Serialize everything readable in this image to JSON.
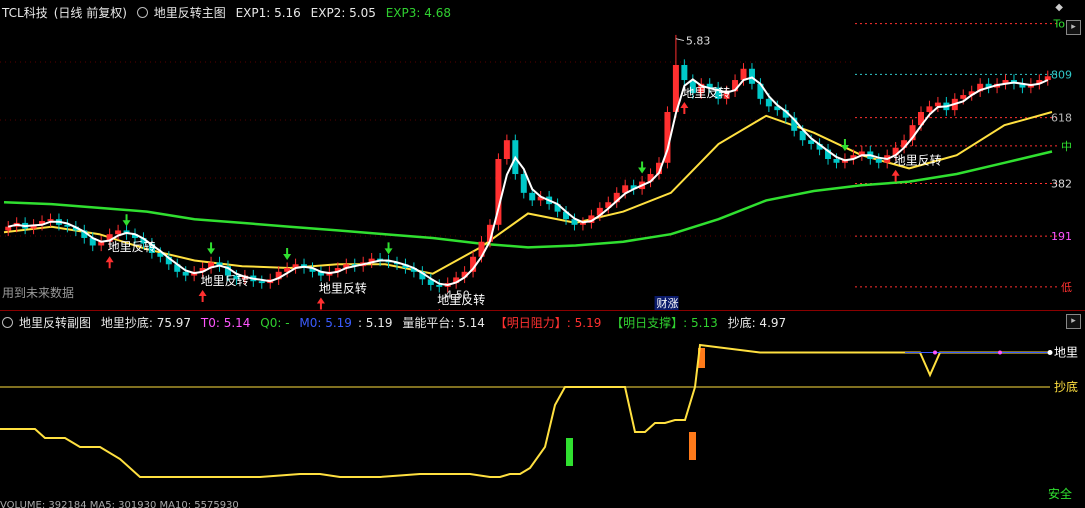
{
  "main_header": {
    "symbol": "TCL科技",
    "mode": "(日线 前复权)",
    "indicator": "地里反转主图",
    "exp1": "EXP1: 5.16",
    "exp2": "EXP2: 5.05",
    "exp3": "EXP3: 4.68"
  },
  "sub_header": {
    "indicator": "地里反转副图",
    "diliang": "地里抄底: 75.97",
    "t0": "T0: 5.14",
    "q0": "Q0: -",
    "m0": "M0: 5.19",
    "val": ": 5.19",
    "platform": "量能平台: 5.14",
    "resist": "【明日阻力】: 5.19",
    "support": "【明日支撑】: 5.13",
    "chaodi": "抄底: 4.97"
  },
  "future_note": "用到未来数据",
  "level_labels": {
    "top": "Top",
    "l809": "809",
    "l618": "618",
    "mid": "中",
    "l382": "382",
    "l191": "191",
    "low": "低"
  },
  "sub_labels": {
    "diliang": "地里",
    "chaodi": "抄底",
    "safe": "安全"
  },
  "footer_text": "VOLUME: 392184 MA5: 301930 MA10: 5575930",
  "colors": {
    "bg": "#000000",
    "up": "#ff3030",
    "down": "#00c8c8",
    "price_line": "#ffffff",
    "ma_yellow": "#ffe040",
    "ma_green": "#30e030",
    "level_dash": "#ff3030",
    "level_cyan": "#30c8c8"
  },
  "chart_data": [
    {
      "type": "candlestick",
      "title": "地里反转主图",
      "y_range": [
        4.45,
        5.95
      ],
      "max_label": "5.83",
      "min_label": "4.50",
      "badge": "财涨",
      "signal_label": "地里反转",
      "signal_bars": [
        12,
        23,
        37,
        51,
        80,
        105
      ],
      "green_arrow_bars": [
        14,
        24,
        33,
        45,
        75,
        99
      ],
      "close": [
        4.84,
        4.86,
        4.83,
        4.85,
        4.87,
        4.88,
        4.85,
        4.84,
        4.82,
        4.78,
        4.74,
        4.76,
        4.8,
        4.82,
        4.8,
        4.78,
        4.75,
        4.7,
        4.68,
        4.64,
        4.6,
        4.58,
        4.6,
        4.62,
        4.65,
        4.63,
        4.58,
        4.56,
        4.58,
        4.55,
        4.54,
        4.56,
        4.6,
        4.62,
        4.64,
        4.62,
        4.6,
        4.58,
        4.6,
        4.62,
        4.64,
        4.63,
        4.65,
        4.67,
        4.66,
        4.65,
        4.64,
        4.62,
        4.6,
        4.56,
        4.53,
        4.52,
        4.54,
        4.57,
        4.6,
        4.68,
        4.76,
        4.85,
        5.2,
        5.3,
        5.12,
        5.02,
        4.98,
        5.0,
        4.96,
        4.92,
        4.88,
        4.85,
        4.86,
        4.9,
        4.94,
        4.97,
        5.02,
        5.06,
        5.04,
        5.08,
        5.12,
        5.18,
        5.45,
        5.7,
        5.62,
        5.55,
        5.6,
        5.58,
        5.52,
        5.56,
        5.62,
        5.68,
        5.6,
        5.52,
        5.48,
        5.46,
        5.42,
        5.35,
        5.3,
        5.28,
        5.25,
        5.2,
        5.18,
        5.2,
        5.22,
        5.24,
        5.2,
        5.18,
        5.22,
        5.26,
        5.3,
        5.38,
        5.45,
        5.48,
        5.5,
        5.46,
        5.52,
        5.54,
        5.56,
        5.6,
        5.58,
        5.6,
        5.62,
        5.6,
        5.58,
        5.6,
        5.62,
        5.64
      ],
      "ma_white_end": 5.64,
      "ma_yellow": [
        4.81,
        4.84,
        4.8,
        4.72,
        4.66,
        4.63,
        4.62,
        4.64,
        4.64,
        4.59,
        4.73,
        4.91,
        4.86,
        4.92,
        5.02,
        5.28,
        5.43,
        5.34,
        5.22,
        5.15,
        5.22,
        5.38,
        5.45
      ],
      "ma_green": [
        4.97,
        4.96,
        4.94,
        4.92,
        4.88,
        4.86,
        4.84,
        4.82,
        4.8,
        4.78,
        4.75,
        4.73,
        4.74,
        4.76,
        4.8,
        4.88,
        4.98,
        5.03,
        5.06,
        5.08,
        5.12,
        5.18,
        5.24
      ],
      "levels": [
        {
          "name": "Top",
          "value": 5.92
        },
        {
          "name": "809",
          "value": 5.65
        },
        {
          "name": "618",
          "value": 5.42
        },
        {
          "name": "中",
          "value": 5.27
        },
        {
          "name": "382",
          "value": 5.07
        },
        {
          "name": "191",
          "value": 4.79
        },
        {
          "name": "低",
          "value": 4.52
        }
      ]
    },
    {
      "type": "line",
      "title": "地里反转副图",
      "y_range": [
        0,
        100
      ],
      "series": [
        {
          "name": "地里抄底",
          "color": "#ffe040",
          "x": [
            0,
            35,
            45,
            65,
            80,
            100,
            120,
            140,
            160,
            180,
            200,
            260,
            300,
            320,
            340,
            380,
            420,
            470,
            490,
            500,
            510,
            520,
            530,
            545,
            555,
            565,
            595,
            625,
            635,
            645,
            655,
            665,
            675,
            685,
            695,
            700,
            760,
            900,
            920,
            930,
            940,
            1050
          ],
          "values": [
            42,
            42,
            36,
            36,
            30,
            30,
            22,
            10,
            10,
            10,
            10,
            10,
            12,
            12,
            10,
            10,
            12,
            12,
            10,
            10,
            12,
            12,
            16,
            30,
            58,
            70,
            70,
            70,
            40,
            40,
            46,
            46,
            48,
            48,
            70,
            98,
            93,
            93,
            93,
            78,
            93,
            93
          ]
        },
        {
          "name": "抄底",
          "color": "#ffe040",
          "flat": 70
        }
      ],
      "bars": [
        {
          "x": 570,
          "value": 36,
          "color": "#30e030"
        },
        {
          "x": 693,
          "value": 40,
          "color": "#ff7a1a"
        },
        {
          "x": 702,
          "value": 16,
          "color": "#ff7a1a"
        }
      ]
    }
  ]
}
